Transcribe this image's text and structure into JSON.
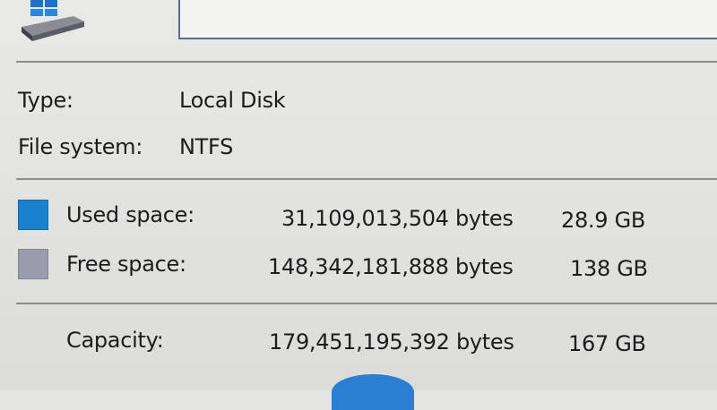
{
  "info": {
    "type_label": "Type:",
    "type_value": "Local Disk",
    "fs_label": "File system:",
    "fs_value": "NTFS"
  },
  "space": {
    "used": {
      "label": "Used space:",
      "bytes": "31,109,013,504 bytes",
      "size": "28.9 GB",
      "color": "#1a82cf"
    },
    "free": {
      "label": "Free space:",
      "bytes": "148,342,181,888 bytes",
      "size": "138 GB",
      "color": "#9a9caa"
    },
    "capacity": {
      "label": "Capacity:",
      "bytes": "179,451,195,392 bytes",
      "size": "167 GB"
    }
  },
  "icons": {
    "drive": "drive-icon"
  },
  "colors": {
    "pie_used": "#2a7fd0"
  }
}
